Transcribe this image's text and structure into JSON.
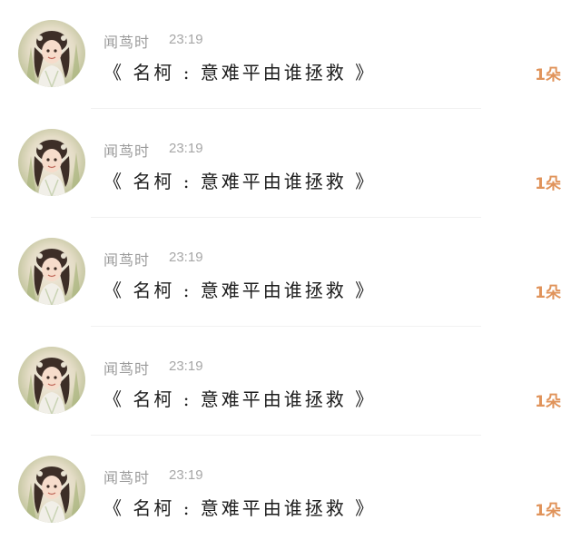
{
  "items": [
    {
      "name": "闻茑时",
      "time": "23:19",
      "message": "《 名柯 : 意难平由谁拯救 》",
      "count": "1朵"
    },
    {
      "name": "闻茑时",
      "time": "23:19",
      "message": "《 名柯 : 意难平由谁拯救 》",
      "count": "1朵"
    },
    {
      "name": "闻茑时",
      "time": "23:19",
      "message": "《 名柯 : 意难平由谁拯救 》",
      "count": "1朵"
    },
    {
      "name": "闻茑时",
      "time": "23:19",
      "message": "《 名柯 : 意难平由谁拯救 》",
      "count": "1朵"
    },
    {
      "name": "闻茑时",
      "time": "23:19",
      "message": "《 名柯 : 意难平由谁拯救 》",
      "count": "1朵"
    }
  ],
  "avatar_icon": "anime-girl-avatar",
  "colors": {
    "count": "#e0935a",
    "meta": "#a7a7a7",
    "message": "#1e1e1e"
  }
}
